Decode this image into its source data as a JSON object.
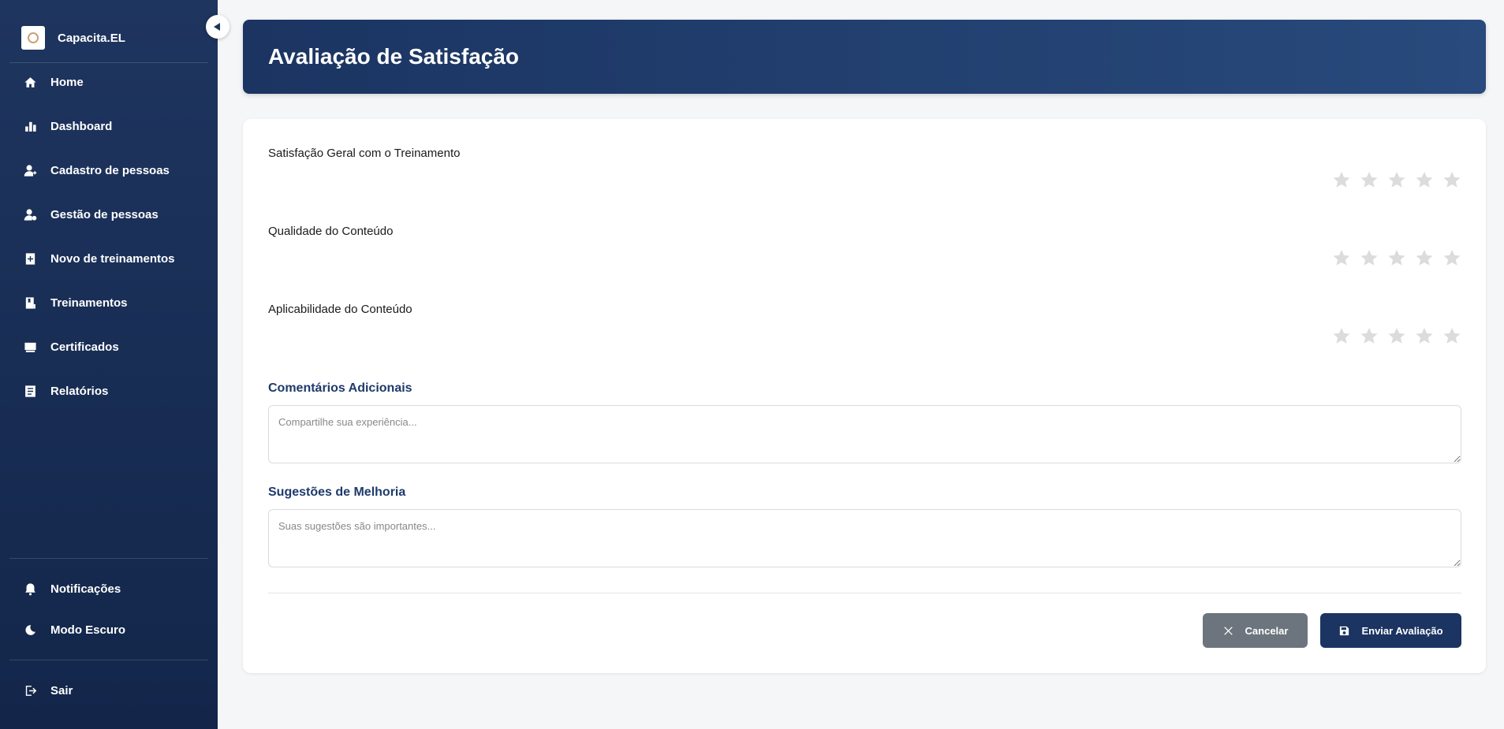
{
  "sidebar": {
    "brand_name": "Capacita.EL",
    "items": [
      {
        "label": "Home",
        "icon": "home-icon"
      },
      {
        "label": "Dashboard",
        "icon": "bar-chart-icon"
      },
      {
        "label": "Cadastro de pessoas",
        "icon": "user-plus-icon"
      },
      {
        "label": "Gestão de pessoas",
        "icon": "user-gear-icon"
      },
      {
        "label": "Novo de treinamentos",
        "icon": "book-plus-icon"
      },
      {
        "label": "Treinamentos",
        "icon": "book-icon"
      },
      {
        "label": "Certificados",
        "icon": "certificate-icon"
      },
      {
        "label": "Relatórios",
        "icon": "report-icon"
      }
    ],
    "bottom_items": [
      {
        "label": "Notificações",
        "icon": "bell-icon"
      },
      {
        "label": "Modo Escuro",
        "icon": "moon-icon"
      }
    ],
    "logout_label": "Sair"
  },
  "header": {
    "title": "Avaliação de Satisfação"
  },
  "form": {
    "ratings": [
      {
        "label": "Satisfação Geral com o Treinamento",
        "value": 0,
        "max": 5
      },
      {
        "label": "Qualidade do Conteúdo",
        "value": 0,
        "max": 5
      },
      {
        "label": "Aplicabilidade do Conteúdo",
        "value": 0,
        "max": 5
      }
    ],
    "comments": {
      "label": "Comentários Adicionais",
      "placeholder": "Compartilhe sua experiência...",
      "value": ""
    },
    "suggestions": {
      "label": "Sugestões de Melhoria",
      "placeholder": "Suas sugestões são importantes...",
      "value": ""
    },
    "cancel_label": "Cancelar",
    "submit_label": "Enviar Avaliação"
  },
  "colors": {
    "sidebar_bg": "#1e355f",
    "header_bg": "#1b3462",
    "accent_text": "#1e3a6b",
    "cancel_bg": "#6c757d",
    "star_empty": "#dcdcdc"
  }
}
